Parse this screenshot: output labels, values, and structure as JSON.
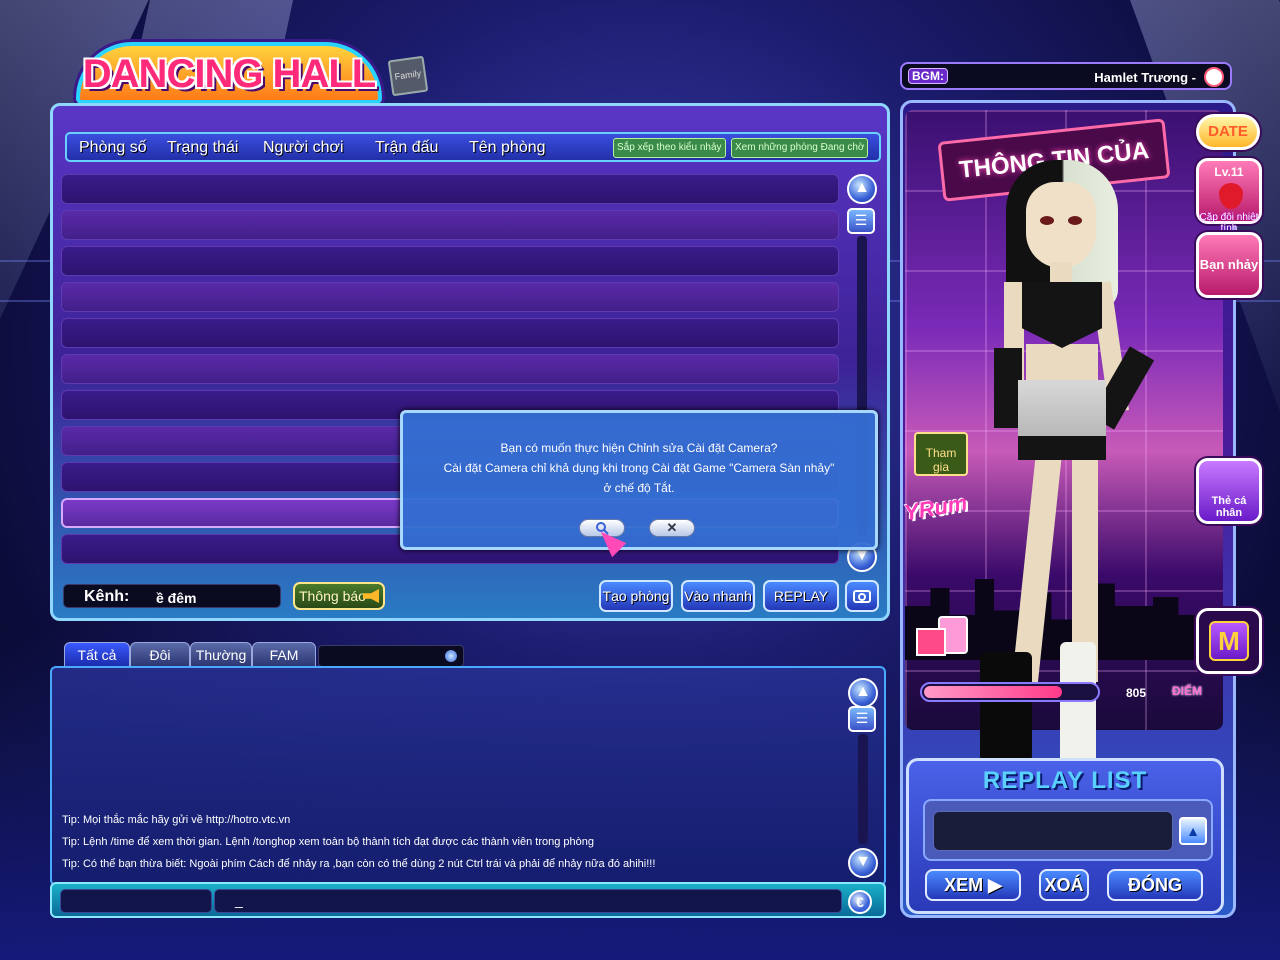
{
  "game": {
    "logo_text": "DANCING HALL",
    "family_icon_text": "Family"
  },
  "room_list": {
    "columns": [
      "Phòng số",
      "Trạng thái",
      "Người chơi",
      "Trận đấu",
      "Tên phòng"
    ],
    "sort_buttons": [
      "Sắp xếp theo kiểu nhảy",
      "Xem những phòng Đang chờ"
    ],
    "row_count": 11,
    "selected_row": 9
  },
  "channel": {
    "label": "Kênh:",
    "value": "ề đêm"
  },
  "notice_button": "Thông báo",
  "actions": {
    "create_room": "Tạo phòng",
    "quick_join": "Vào nhanh",
    "replay": "REPLAY"
  },
  "dialog": {
    "line1": "Bạn có muốn thực hiện Chỉnh sửa Cài đặt Camera?",
    "line2": "Cài đặt Camera chỉ khả dụng khi trong Cài đặt Game \"Camera Sàn nhảy\"",
    "line3": "ở chế độ Tắt.",
    "confirm_icon": "search-icon",
    "cancel_label": "✕"
  },
  "chat": {
    "tabs": [
      "Tất cả",
      "Đôi",
      "Thường",
      "FAM"
    ],
    "active_tab": 0,
    "messages": [
      "Tip: Mọi thắc mắc hãy gửi về http://hotro.vtc.vn",
      "Tip: Lệnh /time để xem thời gian. Lệnh /tonghop xem toàn bộ thành tích đạt được các thành viên trong phòng",
      "Tip: Có thể bạn thừa biết: Ngoài phím Cách để nhảy ra ,bạn còn có thể dùng 2 nút Ctrl trái và phải để nhảy nữa đó ahihi!!!"
    ],
    "input_value": "_",
    "emoji_label": "€"
  },
  "bgm": {
    "label": "BGM:",
    "song": "Hamlet Trương -"
  },
  "profile": {
    "sign_text": "THÔNG TIN CỦA TÔI",
    "date_label": "DATE",
    "level": "Lv.11",
    "level_caption": "Cặp đôi nhiệt tình",
    "partner_label": "Bạn nhảy",
    "join_label": "Tham gia",
    "brand_sticker": "YRum",
    "personal_card": "Thẻ cá nhân",
    "m_label": "M",
    "score": "805",
    "score_unit": "ĐIỂM",
    "score_fill_fraction": 0.8
  },
  "replay_list": {
    "title": "REPLAY LIST",
    "view": "XEM ▶",
    "delete": "XOÁ",
    "close": "ĐÓNG"
  },
  "colors": {
    "accent_blue": "#2438b8",
    "panel_purple": "#3d2296",
    "highlight_pink": "#ff3a8a"
  }
}
